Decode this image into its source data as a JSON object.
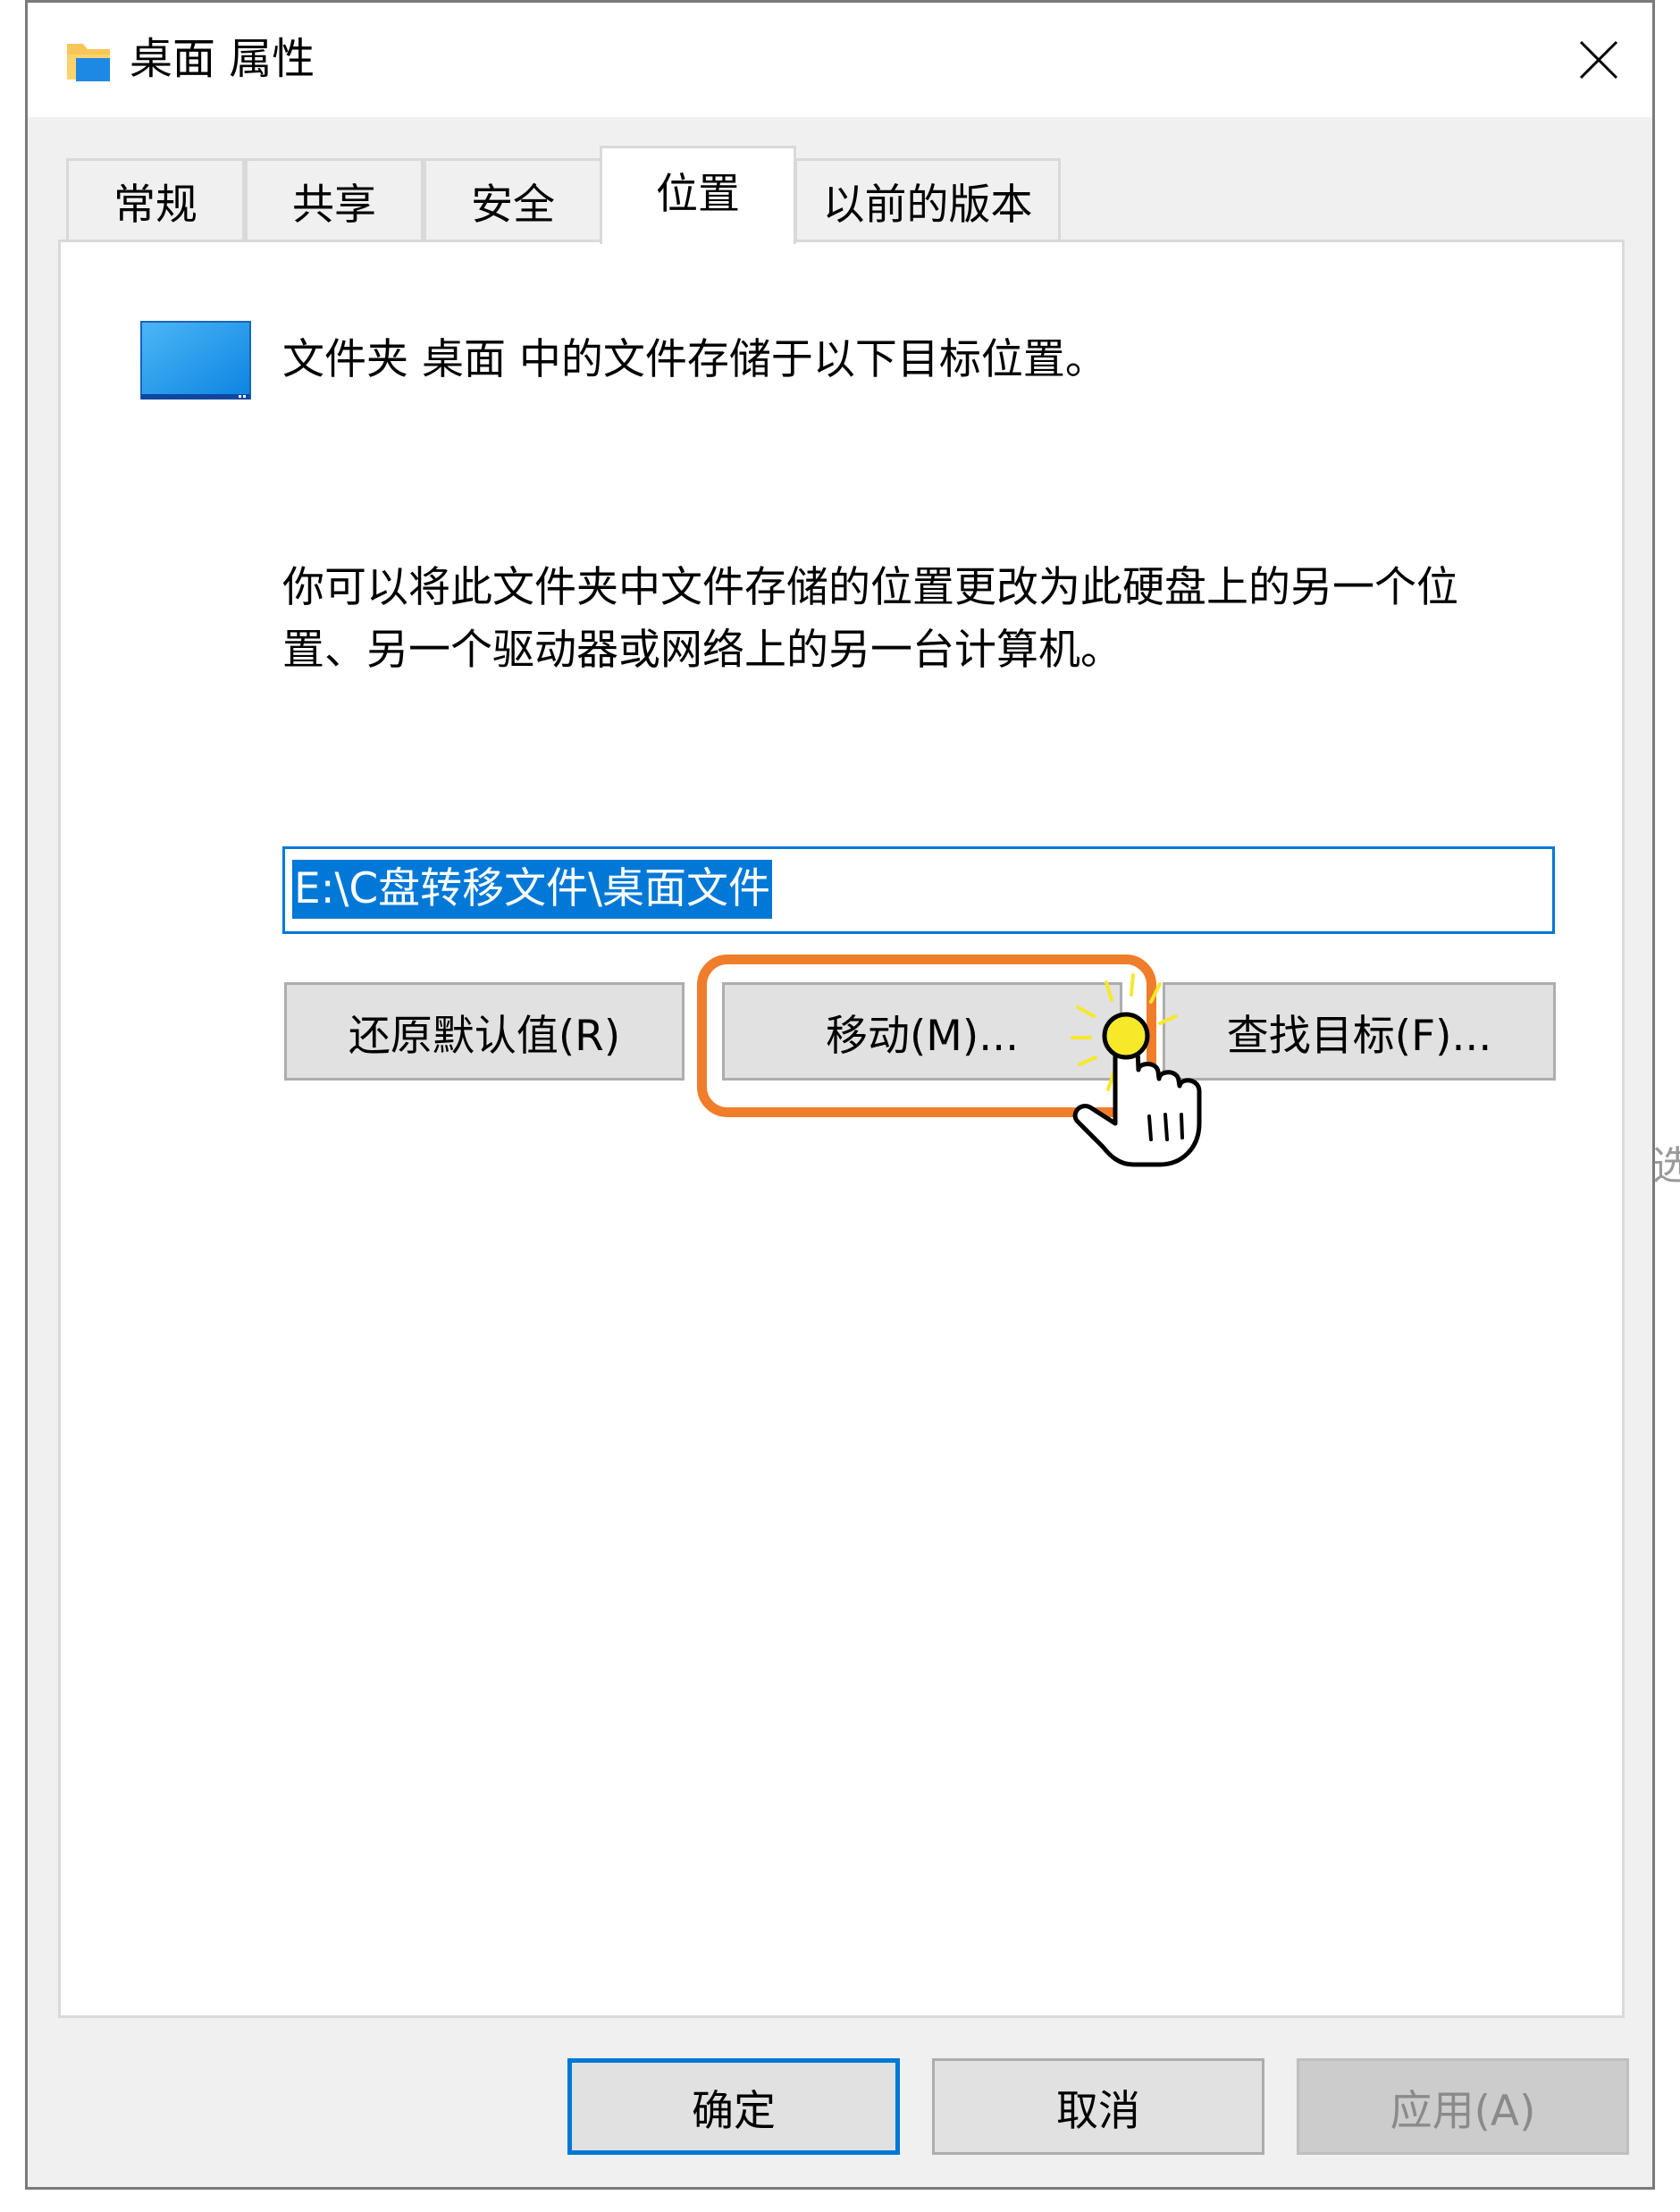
{
  "window": {
    "title": "桌面 属性",
    "title_icon": "folder-icon",
    "close_icon": "close-icon"
  },
  "tabs": [
    {
      "label": "常规",
      "active": false
    },
    {
      "label": "共享",
      "active": false
    },
    {
      "label": "安全",
      "active": false
    },
    {
      "label": "位置",
      "active": true
    },
    {
      "label": "以前的版本",
      "active": false
    }
  ],
  "location": {
    "icon": "desktop-folder-icon",
    "description": "文件夹 桌面 中的文件存储于以下目标位置。",
    "info_line1": "你可以将此文件夹中文件存储的位置更改为此硬盘上的另一个位",
    "info_line2": "置、另一个驱动器或网络上的另一台计算机。",
    "path_value": "E:\\C盘转移文件\\桌面文件",
    "restore_label": "还原默认值(R)",
    "move_label": "移动(M)...",
    "find_label": "查找目标(F)..."
  },
  "footer": {
    "ok_label": "确定",
    "cancel_label": "取消",
    "apply_label": "应用(A)"
  },
  "annotation": {
    "highlight_color": "#f07d2a",
    "pointer_icon": "hand-pointer-icon"
  },
  "edge_glyph": "选"
}
